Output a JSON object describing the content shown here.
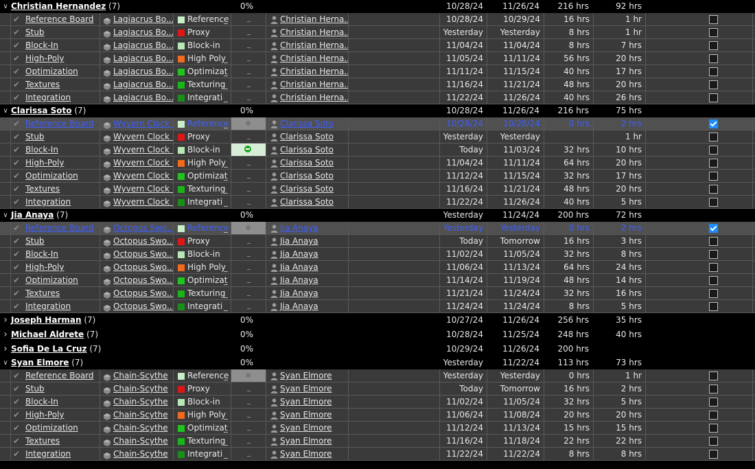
{
  "colors": {
    "Reference": "#c8f0c8",
    "Proxy": "#e01616",
    "Block-in": "#b8e8b8",
    "High Poly": "#f26a1b",
    "Optimizat": "#1fc41f",
    "Texturing": "#19b519",
    "Integrati": "#1a8f1a"
  },
  "groups": [
    {
      "name": "Christian Hernandez",
      "count": "(7)",
      "expanded": true,
      "pct": "0%",
      "start": "10/28/24",
      "due": "11/26/24",
      "bid": "216 hrs",
      "logged": "92 hrs",
      "tasks": [
        {
          "name": "Reference Board",
          "entity": "Lagiacrus Bo...",
          "status": "Reference",
          "assignee": "Christian Herna...",
          "start": "10/28/24",
          "due": "10/29/24",
          "bid": "16 hrs",
          "logged": "1 hr",
          "checked": false,
          "selected": false,
          "marker": "dash"
        },
        {
          "name": "Stub",
          "entity": "Lagiacrus Bo...",
          "status": "Proxy",
          "assignee": "Christian Herna...",
          "start": "Yesterday",
          "due": "Yesterday",
          "bid": "8 hrs",
          "logged": "1 hr",
          "checked": false,
          "selected": false,
          "marker": "dash"
        },
        {
          "name": "Block-In",
          "entity": "Lagiacrus Bo...",
          "status": "Block-in",
          "assignee": "Christian Herna...",
          "start": "11/04/24",
          "due": "11/04/24",
          "bid": "8 hrs",
          "logged": "7 hrs",
          "checked": false,
          "selected": false,
          "marker": "dash"
        },
        {
          "name": "High-Poly",
          "entity": "Lagiacrus Bo...",
          "status": "High Poly",
          "assignee": "Christian Herna...",
          "start": "11/05/24",
          "due": "11/11/24",
          "bid": "56 hrs",
          "logged": "20 hrs",
          "checked": false,
          "selected": false,
          "marker": "dash"
        },
        {
          "name": "Optimization",
          "entity": "Lagiacrus Bo...",
          "status": "Optimizat",
          "assignee": "Christian Herna...",
          "start": "11/11/24",
          "due": "11/15/24",
          "bid": "40 hrs",
          "logged": "17 hrs",
          "checked": false,
          "selected": false,
          "marker": "dash"
        },
        {
          "name": "Textures",
          "entity": "Lagiacrus Bo...",
          "status": "Texturing",
          "assignee": "Christian Herna...",
          "start": "11/16/24",
          "due": "11/21/24",
          "bid": "48 hrs",
          "logged": "20 hrs",
          "checked": false,
          "selected": false,
          "marker": "dash"
        },
        {
          "name": "Integration",
          "entity": "Lagiacrus Bo...",
          "status": "Integrati",
          "assignee": "Christian Herna...",
          "start": "11/22/24",
          "due": "11/26/24",
          "bid": "40 hrs",
          "logged": "26 hrs",
          "checked": false,
          "selected": false,
          "marker": "dash"
        }
      ]
    },
    {
      "name": "Clarissa Soto",
      "count": "(7)",
      "expanded": true,
      "pct": "0%",
      "start": "10/28/24",
      "due": "11/26/24",
      "bid": "216 hrs",
      "logged": "75 hrs",
      "tasks": [
        {
          "name": "Reference Board",
          "entity": "Wyvern Clock ...",
          "status": "Reference",
          "assignee": "Clarissa Soto",
          "start": "10/28/24",
          "due": "10/28/24",
          "bid": "0 hrs",
          "logged": "2 hrs",
          "checked": true,
          "selected": true,
          "marker": "graydot"
        },
        {
          "name": "Stub",
          "entity": "Wyvern Clock ...",
          "status": "Proxy",
          "assignee": "Clarissa Soto",
          "start": "Yesterday",
          "due": "Yesterday",
          "bid": "",
          "logged": "1 hr",
          "checked": false,
          "selected": false,
          "marker": "dash"
        },
        {
          "name": "Block-In",
          "entity": "Wyvern Clock ...",
          "status": "Block-in",
          "assignee": "Clarissa Soto",
          "start": "Today",
          "due": "11/03/24",
          "bid": "32 hrs",
          "logged": "10 hrs",
          "checked": false,
          "selected": false,
          "marker": "greendot"
        },
        {
          "name": "High-Poly",
          "entity": "Wyvern Clock ...",
          "status": "High Poly",
          "assignee": "Clarissa Soto",
          "start": "11/04/24",
          "due": "11/11/24",
          "bid": "64 hrs",
          "logged": "20 hrs",
          "checked": false,
          "selected": false,
          "marker": "dash"
        },
        {
          "name": "Optimization",
          "entity": "Wyvern Clock ...",
          "status": "Optimizat",
          "assignee": "Clarissa Soto",
          "start": "11/12/24",
          "due": "11/15/24",
          "bid": "32 hrs",
          "logged": "17 hrs",
          "checked": false,
          "selected": false,
          "marker": "dash"
        },
        {
          "name": "Textures",
          "entity": "Wyvern Clock ...",
          "status": "Texturing",
          "assignee": "Clarissa Soto",
          "start": "11/16/24",
          "due": "11/21/24",
          "bid": "48 hrs",
          "logged": "20 hrs",
          "checked": false,
          "selected": false,
          "marker": "dash"
        },
        {
          "name": "Integration",
          "entity": "Wyvern Clock ...",
          "status": "Integrati",
          "assignee": "Clarissa Soto",
          "start": "11/22/24",
          "due": "11/26/24",
          "bid": "40 hrs",
          "logged": "5 hrs",
          "checked": false,
          "selected": false,
          "marker": "dash"
        }
      ]
    },
    {
      "name": "Jia Anaya",
      "count": "(7)",
      "expanded": true,
      "pct": "0%",
      "start": "Yesterday",
      "due": "11/24/24",
      "bid": "200 hrs",
      "logged": "72 hrs",
      "tasks": [
        {
          "name": "Reference Board",
          "entity": "Octopus Swo...",
          "status": "Reference",
          "assignee": "Jia Anaya",
          "start": "Yesterday",
          "due": "Yesterday",
          "bid": "0 hrs",
          "logged": "2 hrs",
          "checked": true,
          "selected": true,
          "marker": "graydot"
        },
        {
          "name": "Stub",
          "entity": "Octopus Swo...",
          "status": "Proxy",
          "assignee": "Jia Anaya",
          "start": "Today",
          "due": "Tomorrow",
          "bid": "16 hrs",
          "logged": "3 hrs",
          "checked": false,
          "selected": false,
          "marker": "dash"
        },
        {
          "name": "Block-In",
          "entity": "Octopus Swo...",
          "status": "Block-in",
          "assignee": "Jia Anaya",
          "start": "11/02/24",
          "due": "11/05/24",
          "bid": "32 hrs",
          "logged": "8 hrs",
          "checked": false,
          "selected": false,
          "marker": "dash"
        },
        {
          "name": "High-Poly",
          "entity": "Octopus Swo...",
          "status": "High Poly",
          "assignee": "Jia Anaya",
          "start": "11/06/24",
          "due": "11/13/24",
          "bid": "64 hrs",
          "logged": "24 hrs",
          "checked": false,
          "selected": false,
          "marker": "dash"
        },
        {
          "name": "Optimization",
          "entity": "Octopus Swo...",
          "status": "Optimizat",
          "assignee": "Jia Anaya",
          "start": "11/14/24",
          "due": "11/19/24",
          "bid": "48 hrs",
          "logged": "14 hrs",
          "checked": false,
          "selected": false,
          "marker": "dash"
        },
        {
          "name": "Textures",
          "entity": "Octopus Swo...",
          "status": "Texturing",
          "assignee": "Jia Anaya",
          "start": "11/21/24",
          "due": "11/24/24",
          "bid": "32 hrs",
          "logged": "16 hrs",
          "checked": false,
          "selected": false,
          "marker": "dash"
        },
        {
          "name": "Integration",
          "entity": "Octopus Swo...",
          "status": "Integrati",
          "assignee": "Jia Anaya",
          "start": "11/24/24",
          "due": "11/24/24",
          "bid": "8 hrs",
          "logged": "5 hrs",
          "checked": false,
          "selected": false,
          "marker": "dash"
        }
      ]
    },
    {
      "name": "Joseph Harman",
      "count": "(7)",
      "expanded": false,
      "pct": "0%",
      "start": "10/27/24",
      "due": "11/26/24",
      "bid": "256 hrs",
      "logged": "35 hrs",
      "tasks": []
    },
    {
      "name": "Michael Aldrete",
      "count": "(7)",
      "expanded": false,
      "pct": "0%",
      "start": "10/28/24",
      "due": "11/25/24",
      "bid": "248 hrs",
      "logged": "40 hrs",
      "tasks": []
    },
    {
      "name": "Sofia De La Cruz",
      "count": "(7)",
      "expanded": false,
      "pct": "0%",
      "start": "10/29/24",
      "due": "11/26/24",
      "bid": "200 hrs",
      "logged": "",
      "tasks": []
    },
    {
      "name": "Syan Elmore",
      "count": "(7)",
      "expanded": true,
      "pct": "0%",
      "start": "Yesterday",
      "due": "11/22/24",
      "bid": "113 hrs",
      "logged": "73 hrs",
      "tasks": [
        {
          "name": "Reference Board",
          "entity": "Chain-Scythe",
          "status": "Reference",
          "assignee": "Syan Elmore",
          "start": "Yesterday",
          "due": "Yesterday",
          "bid": "0 hrs",
          "logged": "1 hr",
          "checked": false,
          "selected": false,
          "marker": "graydot"
        },
        {
          "name": "Stub",
          "entity": "Chain-Scythe",
          "status": "Proxy",
          "assignee": "Syan Elmore",
          "start": "Today",
          "due": "Tomorrow",
          "bid": "16 hrs",
          "logged": "2 hrs",
          "checked": false,
          "selected": false,
          "marker": "dash"
        },
        {
          "name": "Block-In",
          "entity": "Chain-Scythe",
          "status": "Block-in",
          "assignee": "Syan Elmore",
          "start": "11/02/24",
          "due": "11/05/24",
          "bid": "32 hrs",
          "logged": "5 hrs",
          "checked": false,
          "selected": false,
          "marker": "dash"
        },
        {
          "name": "High-Poly",
          "entity": "Chain-Scythe",
          "status": "High Poly",
          "assignee": "Syan Elmore",
          "start": "11/06/24",
          "due": "11/08/24",
          "bid": "20 hrs",
          "logged": "20 hrs",
          "checked": false,
          "selected": false,
          "marker": "dash"
        },
        {
          "name": "Optimization",
          "entity": "Chain-Scythe",
          "status": "Optimizat",
          "assignee": "Syan Elmore",
          "start": "11/12/24",
          "due": "11/13/24",
          "bid": "15 hrs",
          "logged": "15 hrs",
          "checked": false,
          "selected": false,
          "marker": "dash"
        },
        {
          "name": "Textures",
          "entity": "Chain-Scythe",
          "status": "Texturing",
          "assignee": "Syan Elmore",
          "start": "11/16/24",
          "due": "11/18/24",
          "bid": "22 hrs",
          "logged": "22 hrs",
          "checked": false,
          "selected": false,
          "marker": "dash"
        },
        {
          "name": "Integration",
          "entity": "Chain-Scythe",
          "status": "Integrati",
          "assignee": "Syan Elmore",
          "start": "11/22/24",
          "due": "11/22/24",
          "bid": "8 hrs",
          "logged": "8 hrs",
          "checked": false,
          "selected": false,
          "marker": "dash"
        }
      ]
    }
  ]
}
